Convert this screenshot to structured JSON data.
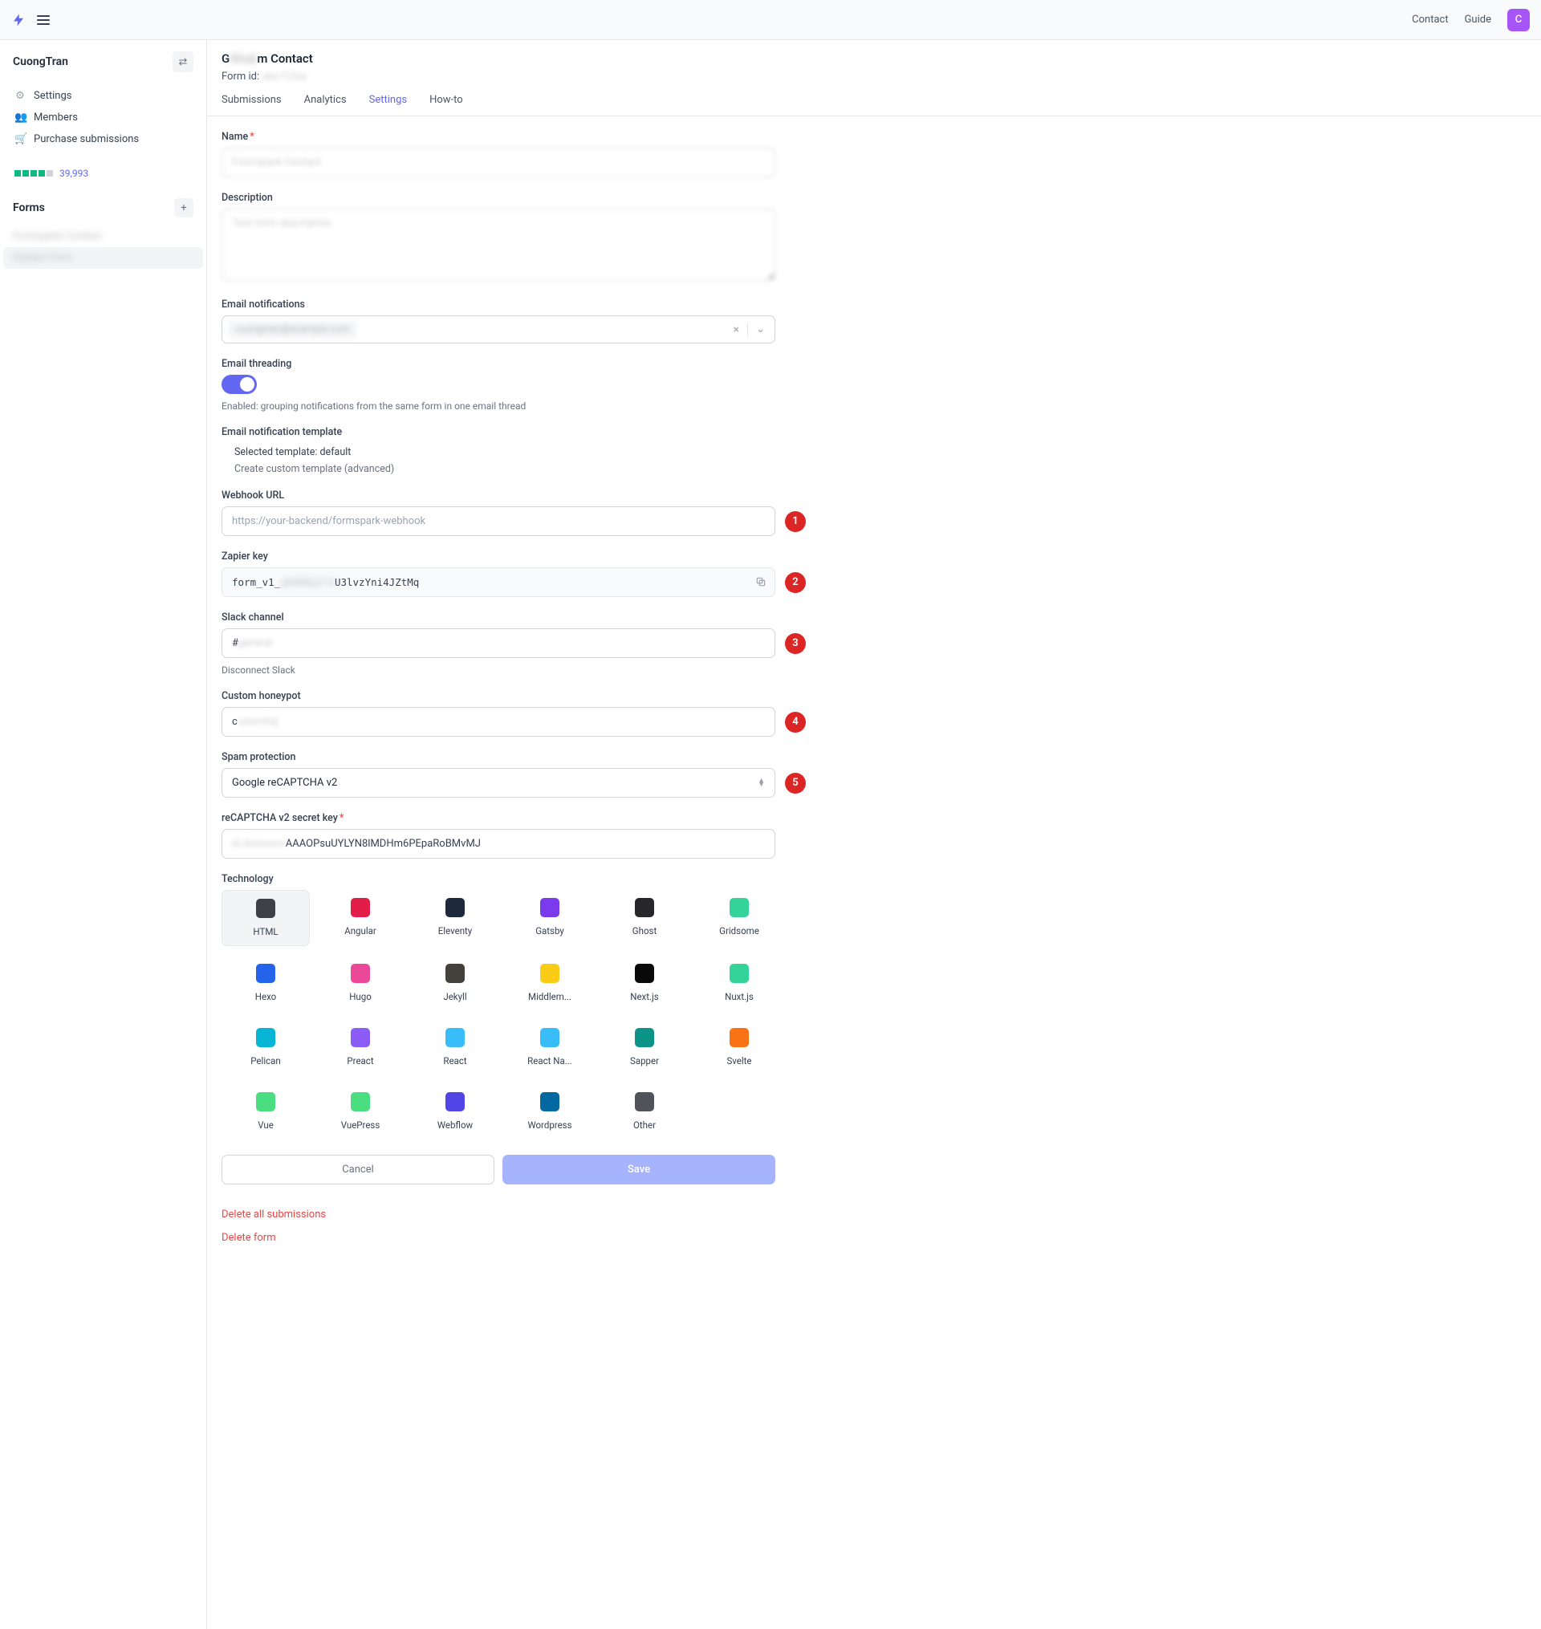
{
  "topbar": {
    "contact": "Contact",
    "guide": "Guide",
    "avatar_initial": "C"
  },
  "sidebar": {
    "workspace": "CuongTran",
    "nav": {
      "settings": "Settings",
      "members": "Members",
      "purchase": "Purchase submissions"
    },
    "rating_count": "39,993",
    "forms_label": "Forms",
    "form_items": [
      "Formspark Contact",
      "Hidden Form"
    ]
  },
  "page": {
    "title_prefix": "G",
    "title_hidden": "ithub",
    "title_suffix": "m Contact",
    "form_id_label": "Form id:",
    "form_id_value": "abc123xy"
  },
  "tabs": {
    "submissions": "Submissions",
    "analytics": "Analytics",
    "settings": "Settings",
    "howto": "How-to"
  },
  "fields": {
    "name_label": "Name",
    "name_value": "Formspark Contact",
    "description_label": "Description",
    "description_value": "Test form description",
    "email_notif_label": "Email notifications",
    "email_notif_chip": "cuongtran@example.com",
    "email_thread_label": "Email threading",
    "email_thread_note": "Enabled: grouping notifications from the same form in one email thread",
    "email_template_label": "Email notification template",
    "email_template_selected": "Selected template: default",
    "email_template_create": "Create custom template (advanced)",
    "webhook_label": "Webhook URL",
    "webhook_placeholder": "https://your-backend/formspark-webhook",
    "zapier_label": "Zapier key",
    "zapier_prefix": "form_v1_",
    "zapier_mid": "qR0M8gZr0",
    "zapier_suffix": "U3lvzYni4JZtMq",
    "slack_label": "Slack channel",
    "slack_prefix": "#",
    "slack_value": "general",
    "slack_disconnect": "Disconnect Slack",
    "honeypot_label": "Custom honeypot",
    "honeypot_prefix": "c",
    "honeypot_value": "ustomhp",
    "spam_label": "Spam protection",
    "spam_value": "Google reCAPTCHA v2",
    "recaptcha_label": "reCAPTCHA v2 secret key",
    "recaptcha_prefix": "6Ldxxxxxxx",
    "recaptcha_suffix": "AAAOPsuUYLYN8lMDHm6PEpaRoBMvMJ",
    "technology_label": "Technology"
  },
  "markers": [
    "1",
    "2",
    "3",
    "4",
    "5"
  ],
  "technologies": [
    {
      "name": "HTML",
      "color": "#3f3f46",
      "selected": true
    },
    {
      "name": "Angular",
      "color": "#e11d48"
    },
    {
      "name": "Eleventy",
      "color": "#1e293b"
    },
    {
      "name": "Gatsby",
      "color": "#7c3aed"
    },
    {
      "name": "Ghost",
      "color": "#27272a"
    },
    {
      "name": "Gridsome",
      "color": "#34d399"
    },
    {
      "name": "Hexo",
      "color": "#2563eb"
    },
    {
      "name": "Hugo",
      "color": "#ec4899"
    },
    {
      "name": "Jekyll",
      "color": "#44403c"
    },
    {
      "name": "Middlem...",
      "color": "#facc15"
    },
    {
      "name": "Next.js",
      "color": "#0a0a0a"
    },
    {
      "name": "Nuxt.js",
      "color": "#34d399"
    },
    {
      "name": "Pelican",
      "color": "#06b6d4"
    },
    {
      "name": "Preact",
      "color": "#8b5cf6"
    },
    {
      "name": "React",
      "color": "#38bdf8"
    },
    {
      "name": "React Na...",
      "color": "#38bdf8"
    },
    {
      "name": "Sapper",
      "color": "#0d9488"
    },
    {
      "name": "Svelte",
      "color": "#f97316"
    },
    {
      "name": "Vue",
      "color": "#4ade80"
    },
    {
      "name": "VuePress",
      "color": "#4ade80"
    },
    {
      "name": "Webflow",
      "color": "#4f46e5"
    },
    {
      "name": "Wordpress",
      "color": "#0369a1"
    },
    {
      "name": "Other",
      "color": "#52525b"
    }
  ],
  "actions": {
    "cancel": "Cancel",
    "save": "Save",
    "delete_submissions": "Delete all submissions",
    "delete_form": "Delete form"
  }
}
